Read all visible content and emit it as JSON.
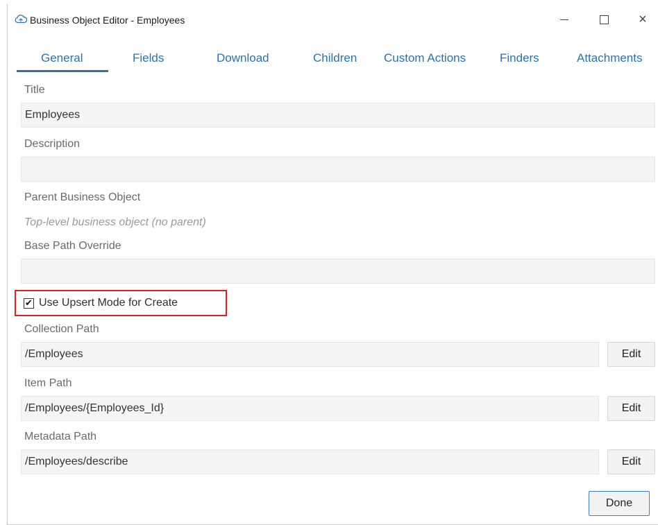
{
  "window": {
    "title": "Business Object Editor - Employees",
    "icon": "cloud-icon",
    "controls": {
      "minimize": "minimize-icon",
      "maximize": "maximize-icon",
      "close": "×"
    }
  },
  "tabs": [
    {
      "label": "General",
      "active": true
    },
    {
      "label": "Fields",
      "active": false
    },
    {
      "label": "Download",
      "active": false
    },
    {
      "label": "Children",
      "active": false
    },
    {
      "label": "Custom Actions",
      "active": false
    },
    {
      "label": "Finders",
      "active": false
    },
    {
      "label": "Attachments",
      "active": false
    }
  ],
  "form": {
    "title_label": "Title",
    "title_value": "Employees",
    "description_label": "Description",
    "description_value": "",
    "parent_label": "Parent Business Object",
    "parent_hint": "Top-level business object (no parent)",
    "base_path_label": "Base Path Override",
    "base_path_value": "",
    "upsert_label": "Use Upsert Mode for Create",
    "upsert_checked": true,
    "upsert_check_glyph": "✔",
    "collection_path_label": "Collection Path",
    "collection_path_value": "/Employees",
    "item_path_label": "Item Path",
    "item_path_value": "/Employees/{Employees_Id}",
    "metadata_path_label": "Metadata Path",
    "metadata_path_value": "/Employees/describe",
    "edit_label": "Edit"
  },
  "actions": {
    "done_label": "Done"
  },
  "colors": {
    "accent": "#2b72ad",
    "highlight_border": "#e02020",
    "field_bg": "#f5f5f5",
    "label": "#6a6a6a"
  }
}
